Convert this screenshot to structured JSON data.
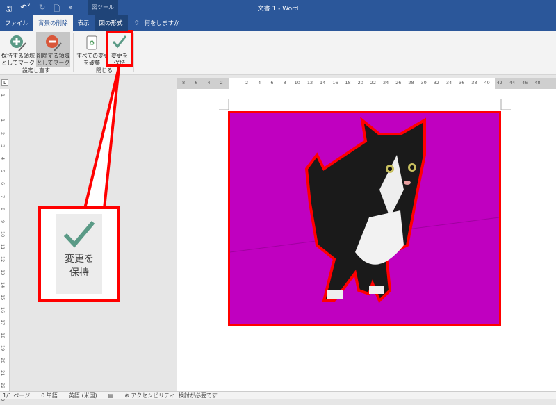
{
  "title_bar": {
    "doc_title": "文書 1  -  Word",
    "context_tab": "図ツール",
    "qat": [
      "save-icon",
      "undo-icon",
      "redo-icon",
      "print-preview-icon",
      "more-icon"
    ]
  },
  "tabs": [
    {
      "label": "ファイル"
    },
    {
      "label": "背景の削除",
      "active": true
    },
    {
      "label": "表示"
    },
    {
      "label": "図の形式"
    },
    {
      "label": "何をしますか"
    }
  ],
  "ribbon": {
    "mark_keep": "保持する領域としてマーク",
    "mark_keep_l1": "保持する領域",
    "mark_keep_l2": "としてマーク",
    "mark_remove_l1": "削除する領域",
    "mark_remove_l2": "としてマーク",
    "group_refine": "設定し直す",
    "discard_l1": "すべての変更",
    "discard_l2": "を破棄",
    "keep_l1": "変更を",
    "keep_l2": "保持",
    "group_close": "閉じる"
  },
  "ruler": {
    "h": [
      "8",
      "6",
      "4",
      "2",
      "",
      "2",
      "4",
      "6",
      "8",
      "10",
      "12",
      "14",
      "16",
      "18",
      "20",
      "22",
      "24",
      "26",
      "28",
      "30",
      "32",
      "34",
      "36",
      "38",
      "40",
      "42",
      "44",
      "46",
      "48"
    ],
    "v": [
      "1",
      "",
      "1",
      "2",
      "3",
      "4",
      "5",
      "6",
      "7",
      "8",
      "9",
      "10",
      "11",
      "12",
      "13",
      "14",
      "15",
      "16",
      "17",
      "18",
      "19",
      "20",
      "21",
      "22",
      "23"
    ]
  },
  "callout": {
    "l1": "変更を",
    "l2": "保持"
  },
  "status": {
    "page": "1/1 ページ",
    "words": "0 単語",
    "lang": "英語 (米国)",
    "accessibility": "アクセシビリティ: 検討が必要です"
  },
  "colors": {
    "brand": "#2b579a",
    "highlight": "#ff0000",
    "removal": "#c000c0",
    "check": "#5a9a86"
  }
}
